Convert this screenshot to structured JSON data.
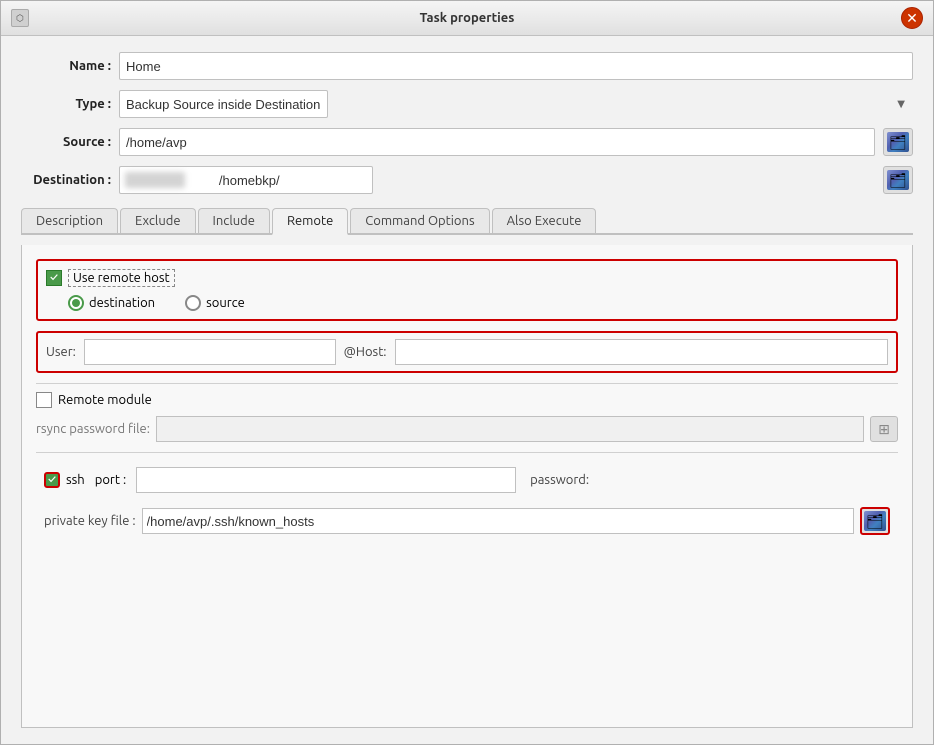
{
  "window": {
    "title": "Task properties"
  },
  "form": {
    "name_label": "Name :",
    "name_value": "Home",
    "type_label": "Type :",
    "type_value": "Backup Source inside Destination",
    "source_label": "Source :",
    "source_value": "/home/avp",
    "destination_label": "Destination :",
    "destination_suffix": "/homebkp/"
  },
  "tabs": [
    {
      "id": "description",
      "label": "Description",
      "active": false
    },
    {
      "id": "exclude",
      "label": "Exclude",
      "active": false
    },
    {
      "id": "include",
      "label": "Include",
      "active": false
    },
    {
      "id": "remote",
      "label": "Remote",
      "active": true
    },
    {
      "id": "command-options",
      "label": "Command Options",
      "active": false
    },
    {
      "id": "also-execute",
      "label": "Also Execute",
      "active": false
    }
  ],
  "remote_tab": {
    "use_remote_host_label": "Use remote host",
    "destination_label": "destination",
    "source_label": "source",
    "user_label": "User:",
    "host_label": "@Host:",
    "user_value": "",
    "host_value": "",
    "remote_module_label": "Remote module",
    "remote_module_checked": false,
    "rsync_password_label": "rsync password file:",
    "rsync_password_value": "",
    "ssh_label": "ssh",
    "port_label": "port :",
    "port_value": "",
    "password_label": "password:",
    "ssh_checked": true,
    "private_key_label": "private key file :",
    "private_key_value": "/home/avp/.ssh/known_hosts"
  }
}
